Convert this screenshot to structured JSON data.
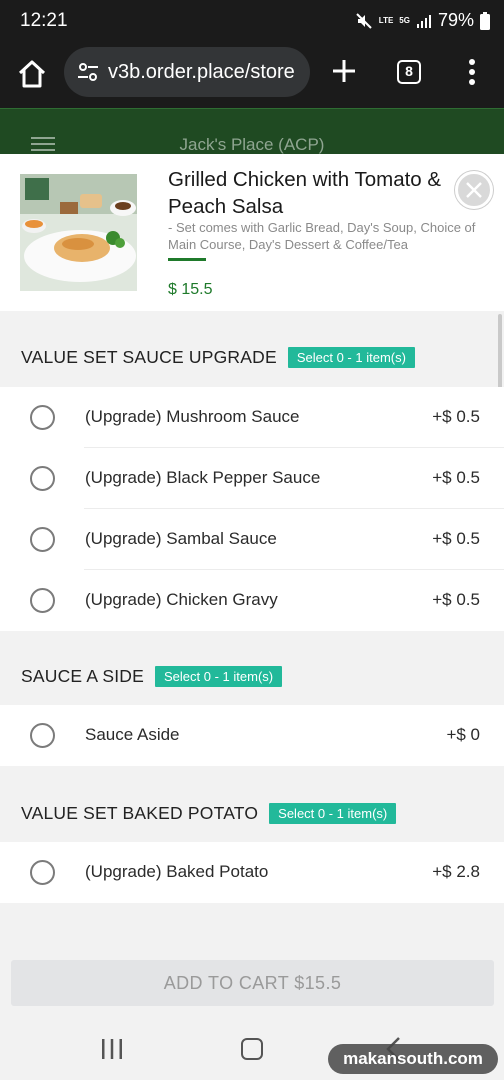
{
  "status_bar": {
    "time": "12:21",
    "battery": "79%",
    "network": "5G",
    "volte": "LTE"
  },
  "browser": {
    "url": "v3b.order.place/store",
    "tab_count": "8"
  },
  "site": {
    "store_name": "Jack's Place (ACP)"
  },
  "product": {
    "name": "Grilled Chicken with Tomato & Peach Salsa",
    "description": "- Set comes with Garlic Bread, Day's Soup, Choice of Main Course, Day's Dessert & Coffee/Tea",
    "price": "$ 15.5"
  },
  "sections": [
    {
      "title": "VALUE SET SAUCE UPGRADE",
      "badge": "Select 0 - 1 item(s)",
      "options": [
        {
          "label": "(Upgrade) Mushroom Sauce",
          "price": "+$ 0.5"
        },
        {
          "label": "(Upgrade) Black Pepper Sauce",
          "price": "+$ 0.5"
        },
        {
          "label": "(Upgrade) Sambal Sauce",
          "price": "+$ 0.5"
        },
        {
          "label": "(Upgrade) Chicken Gravy",
          "price": "+$ 0.5"
        }
      ]
    },
    {
      "title": "SAUCE A SIDE",
      "badge": "Select 0 - 1 item(s)",
      "options": [
        {
          "label": "Sauce Aside",
          "price": "+$ 0"
        }
      ]
    },
    {
      "title": "VALUE SET BAKED POTATO",
      "badge": "Select 0 - 1 item(s)",
      "options": [
        {
          "label": "(Upgrade) Baked Potato",
          "price": "+$ 2.8"
        }
      ]
    }
  ],
  "cart_button": "ADD TO CART $15.5",
  "watermark": "makansouth.com",
  "colors": {
    "accent_green": "#1f7a2b",
    "badge_teal": "#22b99a",
    "header_green": "#1f4a22"
  }
}
